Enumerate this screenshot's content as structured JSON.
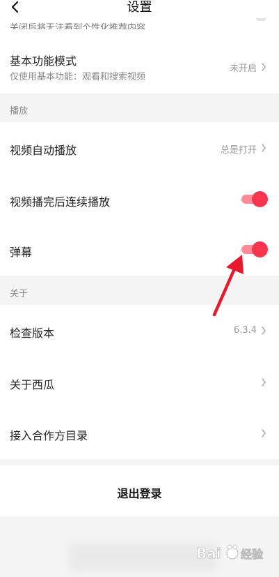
{
  "header": {
    "title": "设置",
    "back_icon": "chevron-left-icon",
    "cut_text": "关闭后将无法看到个性化推荐内容"
  },
  "basic_mode": {
    "title": "基本功能模式",
    "subtitle": "仅使用基本功能：观看和搜索视频",
    "value": "未开启"
  },
  "playback": {
    "section_label": "播放",
    "autoplay": {
      "title": "视频自动播放",
      "value": "总是打开"
    },
    "continuous": {
      "title": "视频播完后连续播放",
      "enabled": true
    },
    "danmaku": {
      "title": "弹幕",
      "enabled": true
    }
  },
  "about": {
    "section_label": "关于",
    "check_version": {
      "title": "检查版本",
      "value": "6.3.4"
    },
    "about_xigua": {
      "title": "关于西瓜"
    },
    "partner_catalog": {
      "title": "接入合作方目录"
    }
  },
  "logout": {
    "label": "退出登录"
  },
  "watermark": {
    "text": "Bai",
    "suffix": "经验"
  },
  "colors": {
    "accent": "#f8354f",
    "toggle_track": "#fd8a94",
    "annotation_arrow": "#e8192c",
    "background": "#f4f4f5"
  }
}
